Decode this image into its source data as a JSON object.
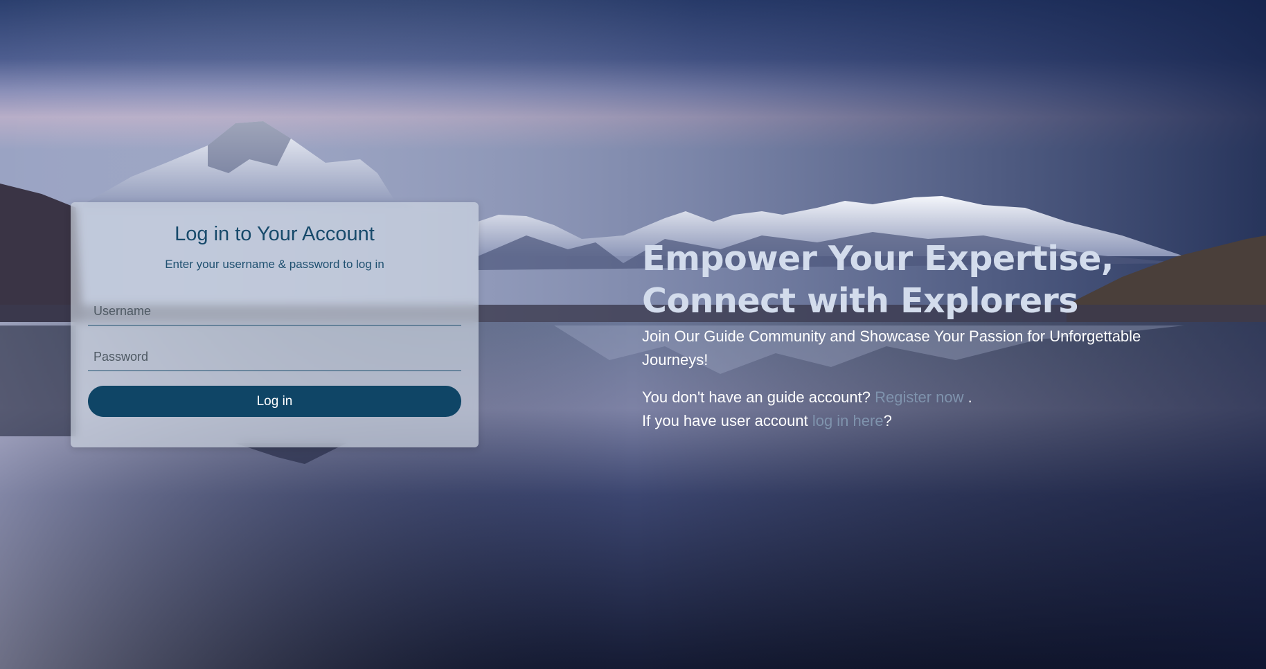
{
  "login": {
    "title": "Log in to Your Account",
    "subtitle": "Enter your username & password to log in",
    "username_placeholder": "Username",
    "password_placeholder": "Password",
    "button_label": "Log in"
  },
  "hero": {
    "title_line1": "Empower Your Expertise,",
    "title_line2": "Connect with Explorers",
    "subtitle": "Join Our Guide Community and Showcase Your Passion for Unforgettable Journeys!",
    "register_prefix": "You don't have an guide account? ",
    "register_link": "Register now",
    "register_suffix": " .",
    "login_prefix": "If you have user account ",
    "login_link": "log in here",
    "login_suffix": "?"
  },
  "colors": {
    "primary": "#0f4566",
    "title_text": "#174a6b",
    "link": "#7f93ad",
    "hero_title": "#d3dcec"
  }
}
